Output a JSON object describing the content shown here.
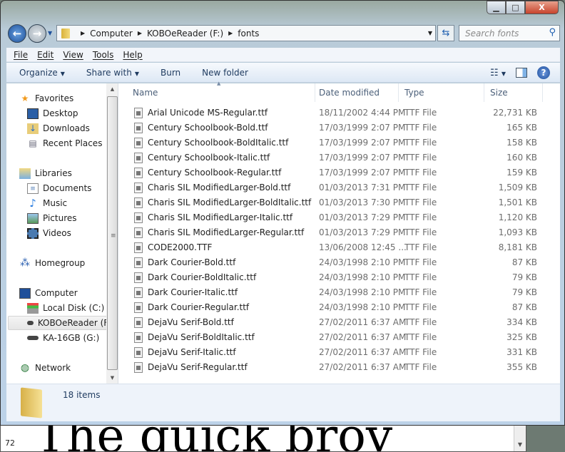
{
  "background_window": {
    "preview_text": "The quick brov",
    "size_label": "72"
  },
  "window": {
    "caption": {
      "minimize": "▁",
      "maximize": "□",
      "close": "X"
    }
  },
  "address": {
    "segments": [
      "Computer",
      "KOBOeReader (F:)",
      "fonts"
    ]
  },
  "search": {
    "placeholder": "Search fonts"
  },
  "menu": [
    "File",
    "Edit",
    "View",
    "Tools",
    "Help"
  ],
  "toolbar": {
    "organize": "Organize",
    "share_with": "Share with",
    "burn": "Burn",
    "new_folder": "New folder"
  },
  "nav": {
    "favorites": {
      "label": "Favorites",
      "items": [
        "Desktop",
        "Downloads",
        "Recent Places"
      ]
    },
    "libraries": {
      "label": "Libraries",
      "items": [
        "Documents",
        "Music",
        "Pictures",
        "Videos"
      ]
    },
    "homegroup": "Homegroup",
    "computer": {
      "label": "Computer",
      "items": [
        "Local Disk (C:)",
        "KOBOeReader (F:)",
        "KA-16GB (G:)"
      ]
    },
    "network": "Network",
    "selected": "KOBOeReader (F:)"
  },
  "columns": {
    "name": "Name",
    "date": "Date modified",
    "type": "Type",
    "size": "Size"
  },
  "files": [
    {
      "name": "Arial Unicode MS-Regular.ttf",
      "date": "18/11/2002 4:44 PM",
      "type": "TTF File",
      "size": "22,731 KB"
    },
    {
      "name": "Century Schoolbook-Bold.ttf",
      "date": "17/03/1999 2:07 PM",
      "type": "TTF File",
      "size": "165 KB"
    },
    {
      "name": "Century Schoolbook-BoldItalic.ttf",
      "date": "17/03/1999 2:07 PM",
      "type": "TTF File",
      "size": "158 KB"
    },
    {
      "name": "Century Schoolbook-Italic.ttf",
      "date": "17/03/1999 2:07 PM",
      "type": "TTF File",
      "size": "160 KB"
    },
    {
      "name": "Century Schoolbook-Regular.ttf",
      "date": "17/03/1999 2:07 PM",
      "type": "TTF File",
      "size": "159 KB"
    },
    {
      "name": "Charis SIL ModifiedLarger-Bold.ttf",
      "date": "01/03/2013 7:31 PM",
      "type": "TTF File",
      "size": "1,509 KB"
    },
    {
      "name": "Charis SIL ModifiedLarger-BoldItalic.ttf",
      "date": "01/03/2013 7:30 PM",
      "type": "TTF File",
      "size": "1,501 KB"
    },
    {
      "name": "Charis SIL ModifiedLarger-Italic.ttf",
      "date": "01/03/2013 7:29 PM",
      "type": "TTF File",
      "size": "1,120 KB"
    },
    {
      "name": "Charis SIL ModifiedLarger-Regular.ttf",
      "date": "01/03/2013 7:29 PM",
      "type": "TTF File",
      "size": "1,093 KB"
    },
    {
      "name": "CODE2000.TTF",
      "date": "13/06/2008 12:45 ...",
      "type": "TTF File",
      "size": "8,181 KB"
    },
    {
      "name": "Dark Courier-Bold.ttf",
      "date": "24/03/1998 2:10 PM",
      "type": "TTF File",
      "size": "87 KB"
    },
    {
      "name": "Dark Courier-BoldItalic.ttf",
      "date": "24/03/1998 2:10 PM",
      "type": "TTF File",
      "size": "79 KB"
    },
    {
      "name": "Dark Courier-Italic.ttf",
      "date": "24/03/1998 2:10 PM",
      "type": "TTF File",
      "size": "79 KB"
    },
    {
      "name": "Dark Courier-Regular.ttf",
      "date": "24/03/1998 2:10 PM",
      "type": "TTF File",
      "size": "87 KB"
    },
    {
      "name": "DejaVu Serif-Bold.ttf",
      "date": "27/02/2011 6:37 AM",
      "type": "TTF File",
      "size": "334 KB"
    },
    {
      "name": "DejaVu Serif-BoldItalic.ttf",
      "date": "27/02/2011 6:37 AM",
      "type": "TTF File",
      "size": "325 KB"
    },
    {
      "name": "DejaVu Serif-Italic.ttf",
      "date": "27/02/2011 6:37 AM",
      "type": "TTF File",
      "size": "331 KB"
    },
    {
      "name": "DejaVu Serif-Regular.ttf",
      "date": "27/02/2011 6:37 AM",
      "type": "TTF File",
      "size": "355 KB"
    }
  ],
  "status": {
    "item_count": "18 items"
  }
}
